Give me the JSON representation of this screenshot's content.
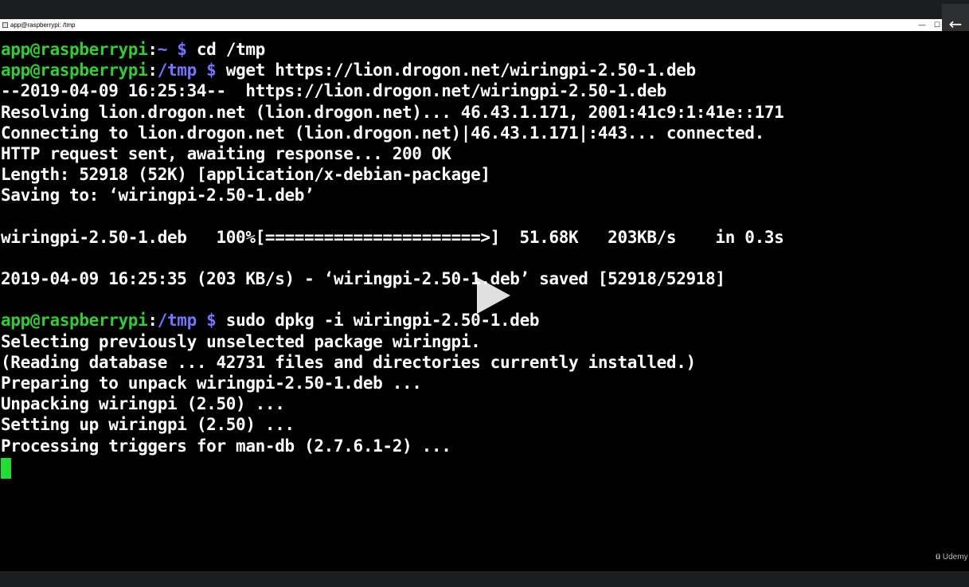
{
  "window": {
    "title": "app@raspberrypi: /tmp",
    "minimize_glyph": "—",
    "maximize_glyph": "☐",
    "close_glyph": "✕"
  },
  "overlay": {
    "back_glyph": "←",
    "watermark_text": "Udemy"
  },
  "terminal": {
    "colors": {
      "prompt_user": "#32cd32",
      "prompt_path": "#7474ff",
      "text": "#ffffff",
      "cursor": "#22dd33"
    },
    "lines": [
      {
        "user": "app@raspberrypi",
        "sep": ":",
        "path": "~",
        "sigil": " $ ",
        "cmd": "cd /tmp"
      },
      {
        "user": "app@raspberrypi",
        "sep": ":",
        "path": "/tmp",
        "sigil": " $ ",
        "cmd": "wget https://lion.drogon.net/wiringpi-2.50-1.deb"
      },
      {
        "text": "--2019-04-09 16:25:34--  https://lion.drogon.net/wiringpi-2.50-1.deb"
      },
      {
        "text": "Resolving lion.drogon.net (lion.drogon.net)... 46.43.1.171, 2001:41c9:1:41e::171"
      },
      {
        "text": "Connecting to lion.drogon.net (lion.drogon.net)|46.43.1.171|:443... connected."
      },
      {
        "text": "HTTP request sent, awaiting response... 200 OK"
      },
      {
        "text": "Length: 52918 (52K) [application/x-debian-package]"
      },
      {
        "text": "Saving to: ‘wiringpi-2.50-1.deb’"
      },
      {
        "text": ""
      },
      {
        "text": "wiringpi-2.50-1.deb   100%[======================>]  51.68K   203KB/s    in 0.3s"
      },
      {
        "text": ""
      },
      {
        "text": "2019-04-09 16:25:35 (203 KB/s) - ‘wiringpi-2.50-1.deb’ saved [52918/52918]"
      },
      {
        "text": ""
      },
      {
        "user": "app@raspberrypi",
        "sep": ":",
        "path": "/tmp",
        "sigil": " $ ",
        "cmd": "sudo dpkg -i wiringpi-2.50-1.deb"
      },
      {
        "text": "Selecting previously unselected package wiringpi."
      },
      {
        "text": "(Reading database ... 42731 files and directories currently installed.)"
      },
      {
        "text": "Preparing to unpack wiringpi-2.50-1.deb ..."
      },
      {
        "text": "Unpacking wiringpi (2.50) ..."
      },
      {
        "text": "Setting up wiringpi (2.50) ..."
      },
      {
        "text": "Processing triggers for man-db (2.7.6.1-2) ..."
      }
    ]
  }
}
